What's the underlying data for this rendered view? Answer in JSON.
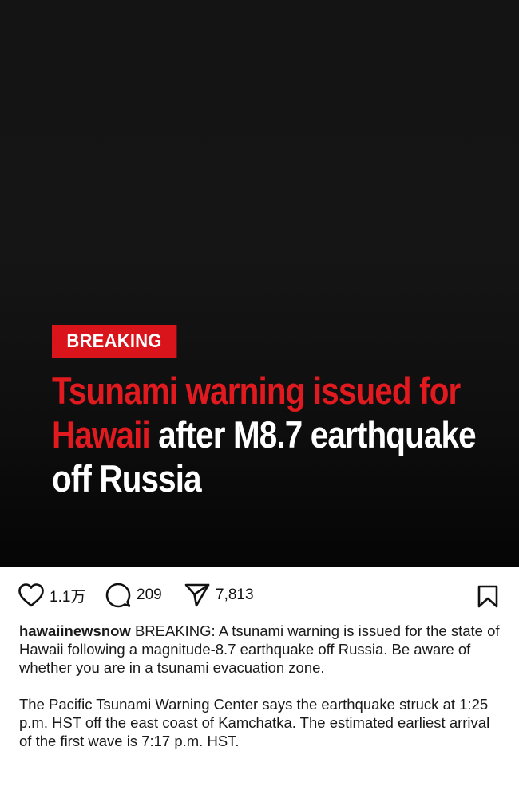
{
  "post": {
    "badge": "BREAKING",
    "headline": {
      "red_part": "Tsunami warning issued for Hawaii",
      "white_part": "after M8.7 earthquake off Russia"
    }
  },
  "actions": {
    "likes": "1.1万",
    "comments": "209",
    "shares": "7,813"
  },
  "caption": {
    "username": "hawaiinewsnow",
    "text_1": "BREAKING: A tsunami warning is issued for the state of Hawaii following a magnitude-8.7 earthquake off Russia. Be aware of whether you are in a tsunami evacuation zone.",
    "text_2": "The Pacific Tsunami Warning Center says the earthquake struck at 1:25 p.m. HST off the east coast of Kamchatka. The estimated earliest arrival of the first wave is 7:17 p.m. HST."
  },
  "colors": {
    "accent_red": "#d9151b",
    "background_dark": "#141414"
  }
}
